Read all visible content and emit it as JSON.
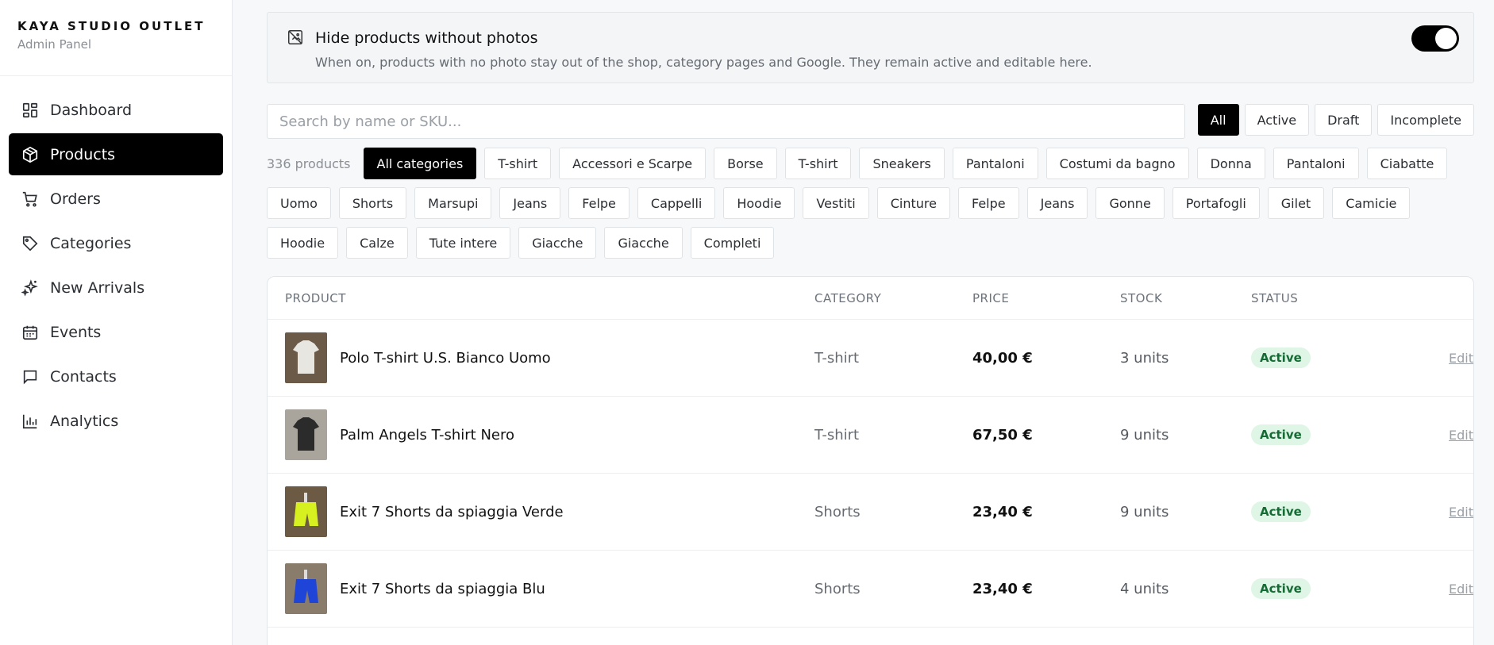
{
  "brand": {
    "name": "KAYA STUDIO OUTLET",
    "subtitle": "Admin Panel"
  },
  "nav": [
    {
      "label": "Dashboard",
      "icon": "dashboard-icon"
    },
    {
      "label": "Products",
      "icon": "box-icon",
      "active": true
    },
    {
      "label": "Orders",
      "icon": "cart-icon"
    },
    {
      "label": "Categories",
      "icon": "tag-icon"
    },
    {
      "label": "New Arrivals",
      "icon": "sparkle-icon"
    },
    {
      "label": "Events",
      "icon": "calendar-icon"
    },
    {
      "label": "Contacts",
      "icon": "chat-icon"
    },
    {
      "label": "Analytics",
      "icon": "bar-chart-icon"
    }
  ],
  "photo_toggle": {
    "title": "Hide products without photos",
    "description": "When on, products with no photo stay out of the shop, category pages and Google. They remain active and editable here.",
    "enabled": true
  },
  "search": {
    "placeholder": "Search by name or SKU..."
  },
  "status_filters": [
    {
      "label": "All",
      "active": true
    },
    {
      "label": "Active"
    },
    {
      "label": "Draft"
    },
    {
      "label": "Incomplete"
    }
  ],
  "product_count": "336 products",
  "categories": [
    "All categories",
    "T-shirt",
    "Accessori e Scarpe",
    "Borse",
    "T-shirt",
    "Sneakers",
    "Pantaloni",
    "Costumi da bagno",
    "Donna",
    "Pantaloni",
    "Ciabatte",
    "Uomo",
    "Shorts",
    "Marsupi",
    "Jeans",
    "Felpe",
    "Cappelli",
    "Hoodie",
    "Vestiti",
    "Cinture",
    "Felpe",
    "Jeans",
    "Gonne",
    "Portafogli",
    "Gilet",
    "Camicie",
    "Hoodie",
    "Calze",
    "Tute intere",
    "Giacche",
    "Giacche",
    "Completi"
  ],
  "table": {
    "headers": {
      "product": "PRODUCT",
      "category": "CATEGORY",
      "price": "PRICE",
      "stock": "STOCK",
      "status": "STATUS"
    },
    "rows": [
      {
        "name": "Polo T-shirt U.S. Bianco Uomo",
        "category": "T-shirt",
        "price": "40,00 €",
        "stock": "3 units",
        "status": "Active",
        "edit": "Edit",
        "thumb_color": "#e8e6e0",
        "thumb_bg": "#6b5a48"
      },
      {
        "name": "Palm Angels T-shirt Nero",
        "category": "T-shirt",
        "price": "67,50 €",
        "stock": "9 units",
        "status": "Active",
        "edit": "Edit",
        "thumb_color": "#2b2b2b",
        "thumb_bg": "#a9a59c"
      },
      {
        "name": "Exit 7 Shorts da spiaggia Verde",
        "category": "Shorts",
        "price": "23,40 €",
        "stock": "9 units",
        "status": "Active",
        "edit": "Edit",
        "thumb_color": "#d7f020",
        "thumb_bg": "#6d5a44"
      },
      {
        "name": "Exit 7 Shorts da spiaggia Blu",
        "category": "Shorts",
        "price": "23,40 €",
        "stock": "4 units",
        "status": "Active",
        "edit": "Edit",
        "thumb_color": "#1e45d8",
        "thumb_bg": "#8a7c6a"
      }
    ]
  },
  "colors": {
    "accent": "#000000",
    "status_active_bg": "#dff5e6",
    "status_active_text": "#146c34"
  }
}
